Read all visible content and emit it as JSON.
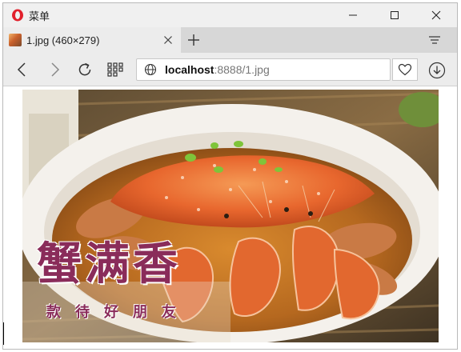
{
  "window": {
    "app_title": "菜单",
    "icons": {
      "app": "opera-logo-icon",
      "minimize": "minimize-icon",
      "maximize": "maximize-icon",
      "close": "close-icon"
    }
  },
  "tab": {
    "title": "1.jpg (460×279)",
    "icons": {
      "favicon": "image-favicon-icon",
      "close": "tab-close-icon",
      "new_tab": "plus-icon",
      "menu": "tab-menu-icon"
    }
  },
  "navigation": {
    "url_host": "localhost",
    "url_rest": ":8888/1.jpg",
    "icons": [
      "back-icon",
      "forward-icon",
      "reload-icon",
      "speed-dial-icon",
      "globe-icon",
      "heart-icon",
      "download-icon"
    ]
  },
  "image": {
    "caption_main": "蟹满香",
    "caption_sub": "款待好朋友",
    "description_icon": "crab-dish-photo"
  },
  "colors": {
    "caption": "#8a2c5a",
    "opera_red": "#e1202c",
    "crab_orange": "#e8672e"
  }
}
